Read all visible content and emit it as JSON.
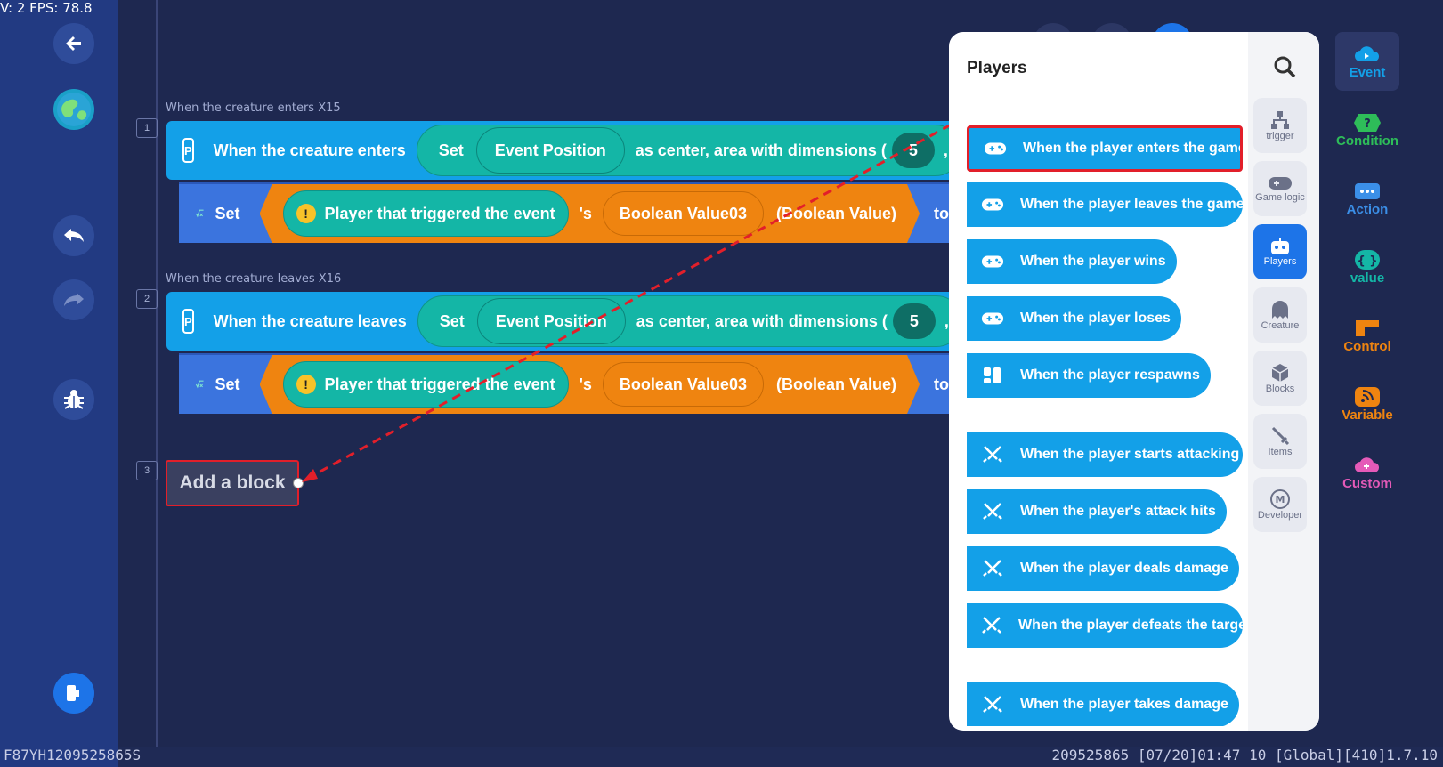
{
  "hud": {
    "fps": "V: 2 FPS: 78.8"
  },
  "rows": [
    {
      "num": "1",
      "label": "When the creature enters X15",
      "event_text": "When the creature enters",
      "set": "Set",
      "position": "Event Position",
      "area": "as center, area with dimensions (",
      "dim": "5",
      "comma": ",",
      "action": {
        "set": "Set",
        "player": "Player that triggered the event",
        "poss": "'s",
        "var": "Boolean Value03",
        "type": "(Boolean Value)",
        "to": "to"
      }
    },
    {
      "num": "2",
      "label": "When the creature leaves X16",
      "event_text": "When the creature leaves",
      "set": "Set",
      "position": "Event Position",
      "area": "as center, area with dimensions (",
      "dim": "5",
      "comma": ",",
      "action": {
        "set": "Set",
        "player": "Player that triggered the event",
        "poss": "'s",
        "var": "Boolean Value03",
        "type": "(Boolean Value)",
        "to": "to"
      }
    }
  ],
  "add_block": {
    "num": "3",
    "label": "Add a block"
  },
  "panel": {
    "title": "Players",
    "items": [
      "When the player enters the game",
      "When the player leaves the game",
      "When the player wins",
      "When the player loses",
      "When the player respawns",
      "When the player starts attacking",
      "When the player's attack hits",
      "When the player deals damage",
      "When the player defeats the target",
      "When the player takes damage"
    ],
    "categories": [
      "trigger",
      "Game logic",
      "Players",
      "Creature",
      "Blocks",
      "Items",
      "Developer"
    ]
  },
  "main_categories": [
    "Event",
    "Condition",
    "Action",
    "value",
    "Control",
    "Variable",
    "Custom"
  ],
  "colors": {
    "event": "#13a0e8",
    "condition": "#2ebd59",
    "action": "#3b74de",
    "value": "#14b6a6",
    "control": "#ef8410",
    "variable": "#ef8410",
    "custom": "#e55ab8"
  },
  "footer": {
    "left": "F87YH1209525865S",
    "right": "209525865   [07/20]01:47 10  [Global][410]1.7.10"
  }
}
